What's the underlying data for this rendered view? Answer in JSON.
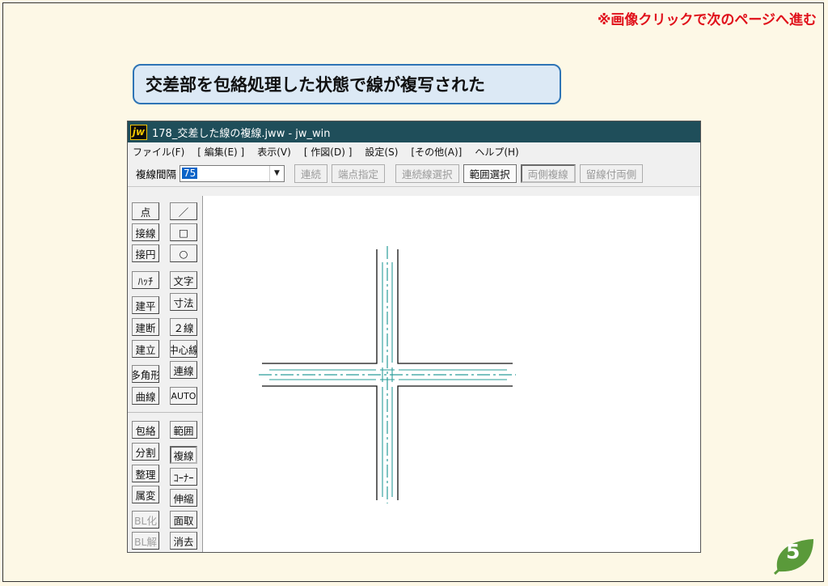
{
  "slide": {
    "nav_note": "※画像クリックで次のページへ進む",
    "callout": "交差部を包絡処理した状態で線が複写された",
    "page_number": "5"
  },
  "app": {
    "icon_text": "jw",
    "title": "178_交差した線の複線.jww - jw_win",
    "menu": [
      "ファイル(F)",
      "[ 編集(E) ]",
      "表示(V)",
      "[ 作図(D) ]",
      "設定(S)",
      "[その他(A)]",
      "ヘルプ(H)"
    ],
    "toolbar": {
      "label": "複線間隔",
      "value": "75",
      "buttons": [
        "連続",
        "端点指定",
        "連続線選択",
        "範囲選択",
        "両側複線",
        "留線付両側"
      ]
    },
    "left_col1": [
      "点",
      "接線",
      "接円",
      "ﾊｯﾁ",
      "建平",
      "建断",
      "建立",
      "多角形",
      "曲線",
      "包絡",
      "分割",
      "整理",
      "属変",
      "BL化",
      "BL解"
    ],
    "left_col2": [
      "／",
      "□",
      "○",
      "文字",
      "寸法",
      "２線",
      "中心線",
      "連線",
      "AUTO",
      "範囲",
      "複線",
      "ｺｰﾅｰ",
      "伸縮",
      "面取",
      "消去"
    ]
  },
  "colors": {
    "accent_red": "#e0101a",
    "callout_border": "#2e74b5",
    "titlebar": "#1f4e5a",
    "centerline": "#2a9d9a",
    "page_leaf": "#5a9a3a"
  }
}
